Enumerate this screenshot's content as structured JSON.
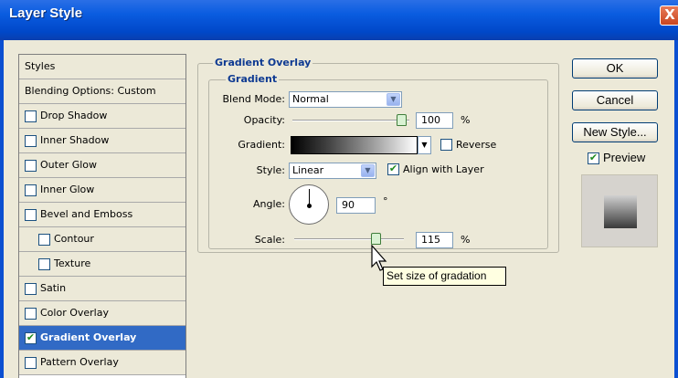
{
  "window": {
    "title": "Layer Style",
    "close_label": "X"
  },
  "styles_list": {
    "header": "Styles",
    "blending": "Blending Options: Custom",
    "items": [
      {
        "label": "Drop Shadow",
        "checked": false,
        "indent": false
      },
      {
        "label": "Inner Shadow",
        "checked": false,
        "indent": false
      },
      {
        "label": "Outer Glow",
        "checked": false,
        "indent": false
      },
      {
        "label": "Inner Glow",
        "checked": false,
        "indent": false
      },
      {
        "label": "Bevel and Emboss",
        "checked": false,
        "indent": false
      },
      {
        "label": "Contour",
        "checked": false,
        "indent": true
      },
      {
        "label": "Texture",
        "checked": false,
        "indent": true
      },
      {
        "label": "Satin",
        "checked": false,
        "indent": false
      },
      {
        "label": "Color Overlay",
        "checked": false,
        "indent": false
      },
      {
        "label": "Gradient Overlay",
        "checked": true,
        "indent": false,
        "selected": true
      },
      {
        "label": "Pattern Overlay",
        "checked": false,
        "indent": false
      }
    ]
  },
  "gradient_overlay": {
    "group_title": "Gradient Overlay",
    "subgroup_title": "Gradient",
    "blend_mode": {
      "label": "Blend Mode:",
      "value": "Normal"
    },
    "opacity": {
      "label": "Opacity:",
      "value": "100",
      "unit": "%",
      "level": 100
    },
    "gradient": {
      "label": "Gradient:",
      "reverse_label": "Reverse",
      "reverse_checked": false
    },
    "style": {
      "label": "Style:",
      "value": "Linear",
      "align_label": "Align with Layer",
      "align_checked": true
    },
    "angle": {
      "label": "Angle:",
      "value": "90",
      "unit": "°"
    },
    "scale": {
      "label": "Scale:",
      "value": "115",
      "unit": "%",
      "level": 115
    }
  },
  "buttons": {
    "ok": "OK",
    "cancel": "Cancel",
    "new_style": "New Style...",
    "preview_label": "Preview",
    "preview_checked": true
  },
  "tooltip": "Set size of gradation",
  "icons": {
    "check": "check-icon",
    "dropdown": "chevron-down-icon",
    "cursor": "arrow-cursor-icon"
  }
}
